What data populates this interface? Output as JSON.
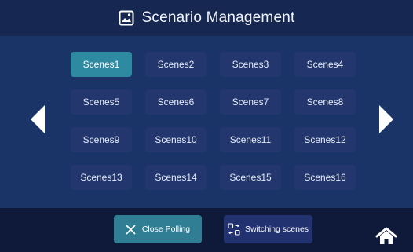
{
  "header": {
    "title": "Scenario Management",
    "icon": "image-icon"
  },
  "navigation": {
    "prev_icon": "triangle-left-icon",
    "next_icon": "triangle-right-icon",
    "home_icon": "home-icon"
  },
  "scenes": [
    "Scenes1",
    "Scenes2",
    "Scenes3",
    "Scenes4",
    "Scenes5",
    "Scenes6",
    "Scenes7",
    "Scenes8",
    "Scenes9",
    "Scenes10",
    "Scenes11",
    "Scenes12",
    "Scenes13",
    "Scenes14",
    "Scenes15",
    "Scenes16"
  ],
  "selected_scene": "Scenes1",
  "footer": {
    "close_polling": {
      "label": "Close Polling",
      "icon": "close-icon"
    },
    "switching_scenes": {
      "label": "Switching scenes",
      "icon": "switch-icon"
    }
  },
  "colors": {
    "header_bg": "#162751",
    "panel_bg": "#1a3467",
    "background": "#0f1a3a",
    "scene_button": "#23366e",
    "accent_teal": "#2e8aa0"
  }
}
